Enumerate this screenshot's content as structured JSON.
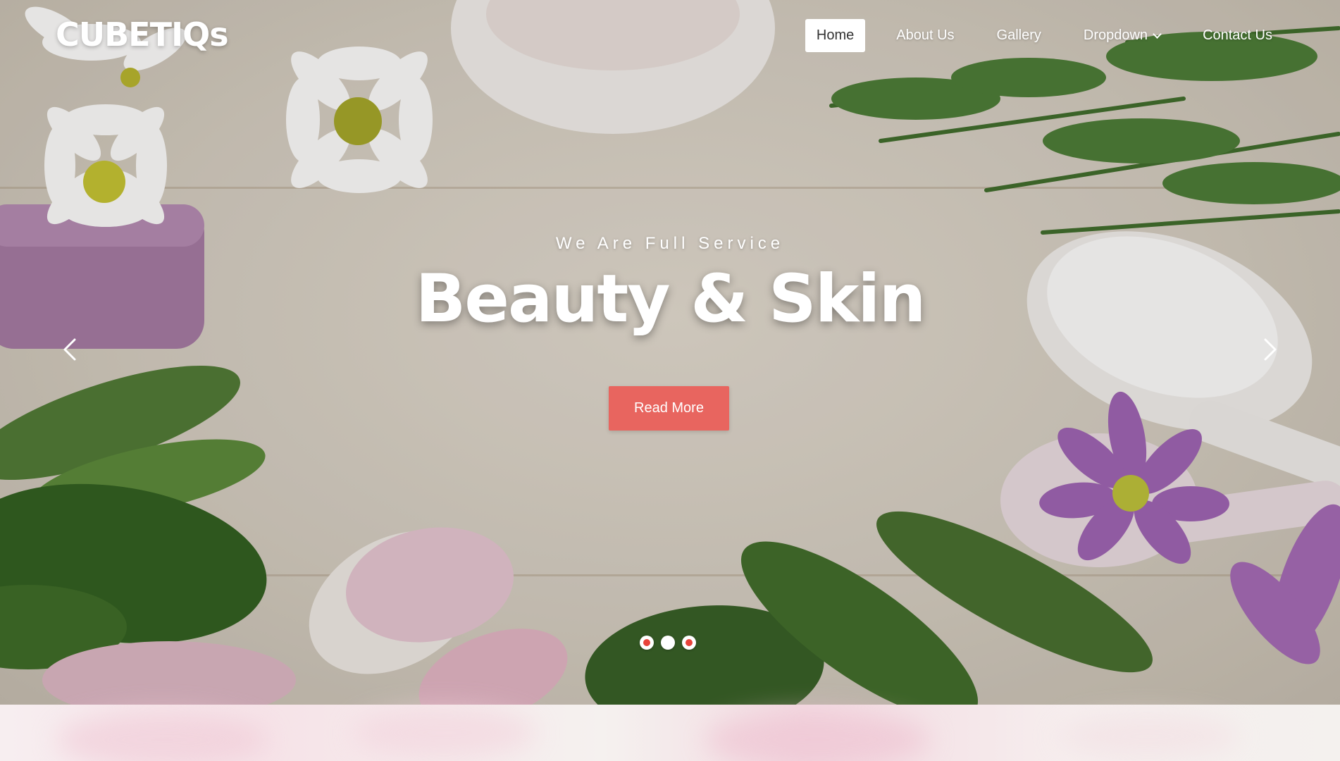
{
  "brand": {
    "logo_text": "CUBETIQs"
  },
  "nav": {
    "items": [
      {
        "label": "Home",
        "active": true
      },
      {
        "label": "About Us",
        "active": false
      },
      {
        "label": "Gallery",
        "active": false
      },
      {
        "label": "Dropdown",
        "active": false,
        "has_submenu": true
      },
      {
        "label": "Contact Us",
        "active": false
      }
    ]
  },
  "hero": {
    "kicker": "We Are Full Service",
    "headline": "Beauty & Skin",
    "cta_label": "Read More",
    "prev_icon": "chevron-left-icon",
    "next_icon": "chevron-right-icon",
    "slides_total": 3,
    "active_slide": 2
  },
  "colors": {
    "accent": "#e8655f",
    "dot_fill": "#e8433a",
    "text_on_hero": "#ffffff"
  }
}
